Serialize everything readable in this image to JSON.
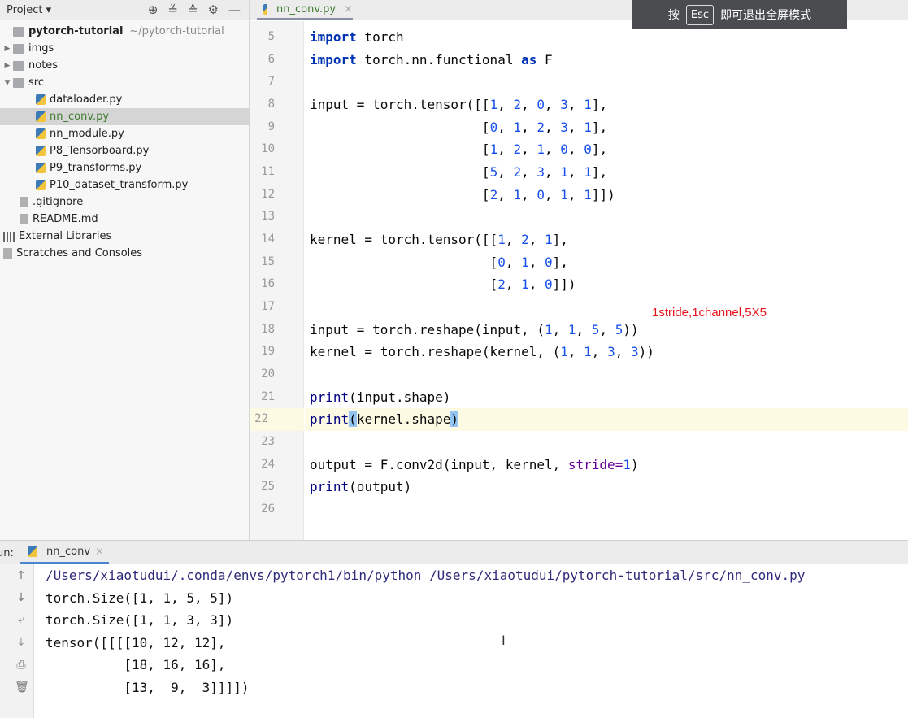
{
  "sidebar": {
    "title": "Project",
    "items": [
      {
        "label": "pytorch-tutorial",
        "path": "~/pytorch-tutorial",
        "icon": "folder-icon",
        "depth": 0,
        "arrow": "",
        "bold": true
      },
      {
        "label": "imgs",
        "icon": "folder-icon",
        "depth": 0,
        "arrow": "▶"
      },
      {
        "label": "notes",
        "icon": "folder-icon",
        "depth": 0,
        "arrow": "▶"
      },
      {
        "label": "src",
        "icon": "folder-icon",
        "depth": 0,
        "arrow": "▼"
      },
      {
        "label": "dataloader.py",
        "icon": "python-file-icon",
        "depth": 2
      },
      {
        "label": "nn_conv.py",
        "icon": "python-file-icon",
        "depth": 2,
        "selected": true
      },
      {
        "label": "nn_module.py",
        "icon": "python-file-icon",
        "depth": 2
      },
      {
        "label": "P8_Tensorboard.py",
        "icon": "python-file-icon",
        "depth": 2
      },
      {
        "label": "P9_transforms.py",
        "icon": "python-file-icon",
        "depth": 2
      },
      {
        "label": "P10_dataset_transform.py",
        "icon": "python-file-icon",
        "depth": 2
      },
      {
        "label": ".gitignore",
        "icon": "file-icon",
        "depth": 1
      },
      {
        "label": "README.md",
        "icon": "markdown-file-icon",
        "depth": 1
      },
      {
        "label": "External Libraries",
        "icon": "library-icon",
        "depth": -1
      },
      {
        "label": "Scratches and Consoles",
        "icon": "scratches-icon",
        "depth": -1
      }
    ]
  },
  "editor": {
    "tab": "nn_conv.py",
    "current_line": 22,
    "lines": [
      {
        "n": "5",
        "code": "import torch"
      },
      {
        "n": "6",
        "code": "import torch.nn.functional as F"
      },
      {
        "n": "7",
        "code": ""
      },
      {
        "n": "8",
        "code": "input = torch.tensor([[1, 2, 0, 3, 1],"
      },
      {
        "n": "9",
        "code": "                      [0, 1, 2, 3, 1],"
      },
      {
        "n": "10",
        "code": "                      [1, 2, 1, 0, 0],"
      },
      {
        "n": "11",
        "code": "                      [5, 2, 3, 1, 1],"
      },
      {
        "n": "12",
        "code": "                      [2, 1, 0, 1, 1]])"
      },
      {
        "n": "13",
        "code": ""
      },
      {
        "n": "14",
        "code": "kernel = torch.tensor([[1, 2, 1],"
      },
      {
        "n": "15",
        "code": "                       [0, 1, 0],"
      },
      {
        "n": "16",
        "code": "                       [2, 1, 0]])"
      },
      {
        "n": "17",
        "code": ""
      },
      {
        "n": "18",
        "code": "input = torch.reshape(input, (1, 1, 5, 5))"
      },
      {
        "n": "19",
        "code": "kernel = torch.reshape(kernel, (1, 1, 3, 3))"
      },
      {
        "n": "20",
        "code": ""
      },
      {
        "n": "21",
        "code": "print(input.shape)"
      },
      {
        "n": "22",
        "code": "print(kernel.shape)"
      },
      {
        "n": "23",
        "code": ""
      },
      {
        "n": "24",
        "code": "output = F.conv2d(input, kernel, stride=1)"
      },
      {
        "n": "25",
        "code": "print(output)"
      },
      {
        "n": "26",
        "code": ""
      }
    ]
  },
  "annotation": "1stride,1channel,5X5",
  "toast": {
    "before": "按",
    "key": "Esc",
    "after": "即可退出全屏模式"
  },
  "run": {
    "label": "un:",
    "tab": "nn_conv",
    "output": [
      "/Users/xiaotudui/.conda/envs/pytorch1/bin/python /Users/xiaotudui/pytorch-tutorial/src/nn_conv.py",
      "torch.Size([1, 1, 5, 5])",
      "torch.Size([1, 1, 3, 3])",
      "tensor([[[[10, 12, 12],",
      "          [18, 16, 16],",
      "          [13,  9,  3]]]])"
    ]
  }
}
